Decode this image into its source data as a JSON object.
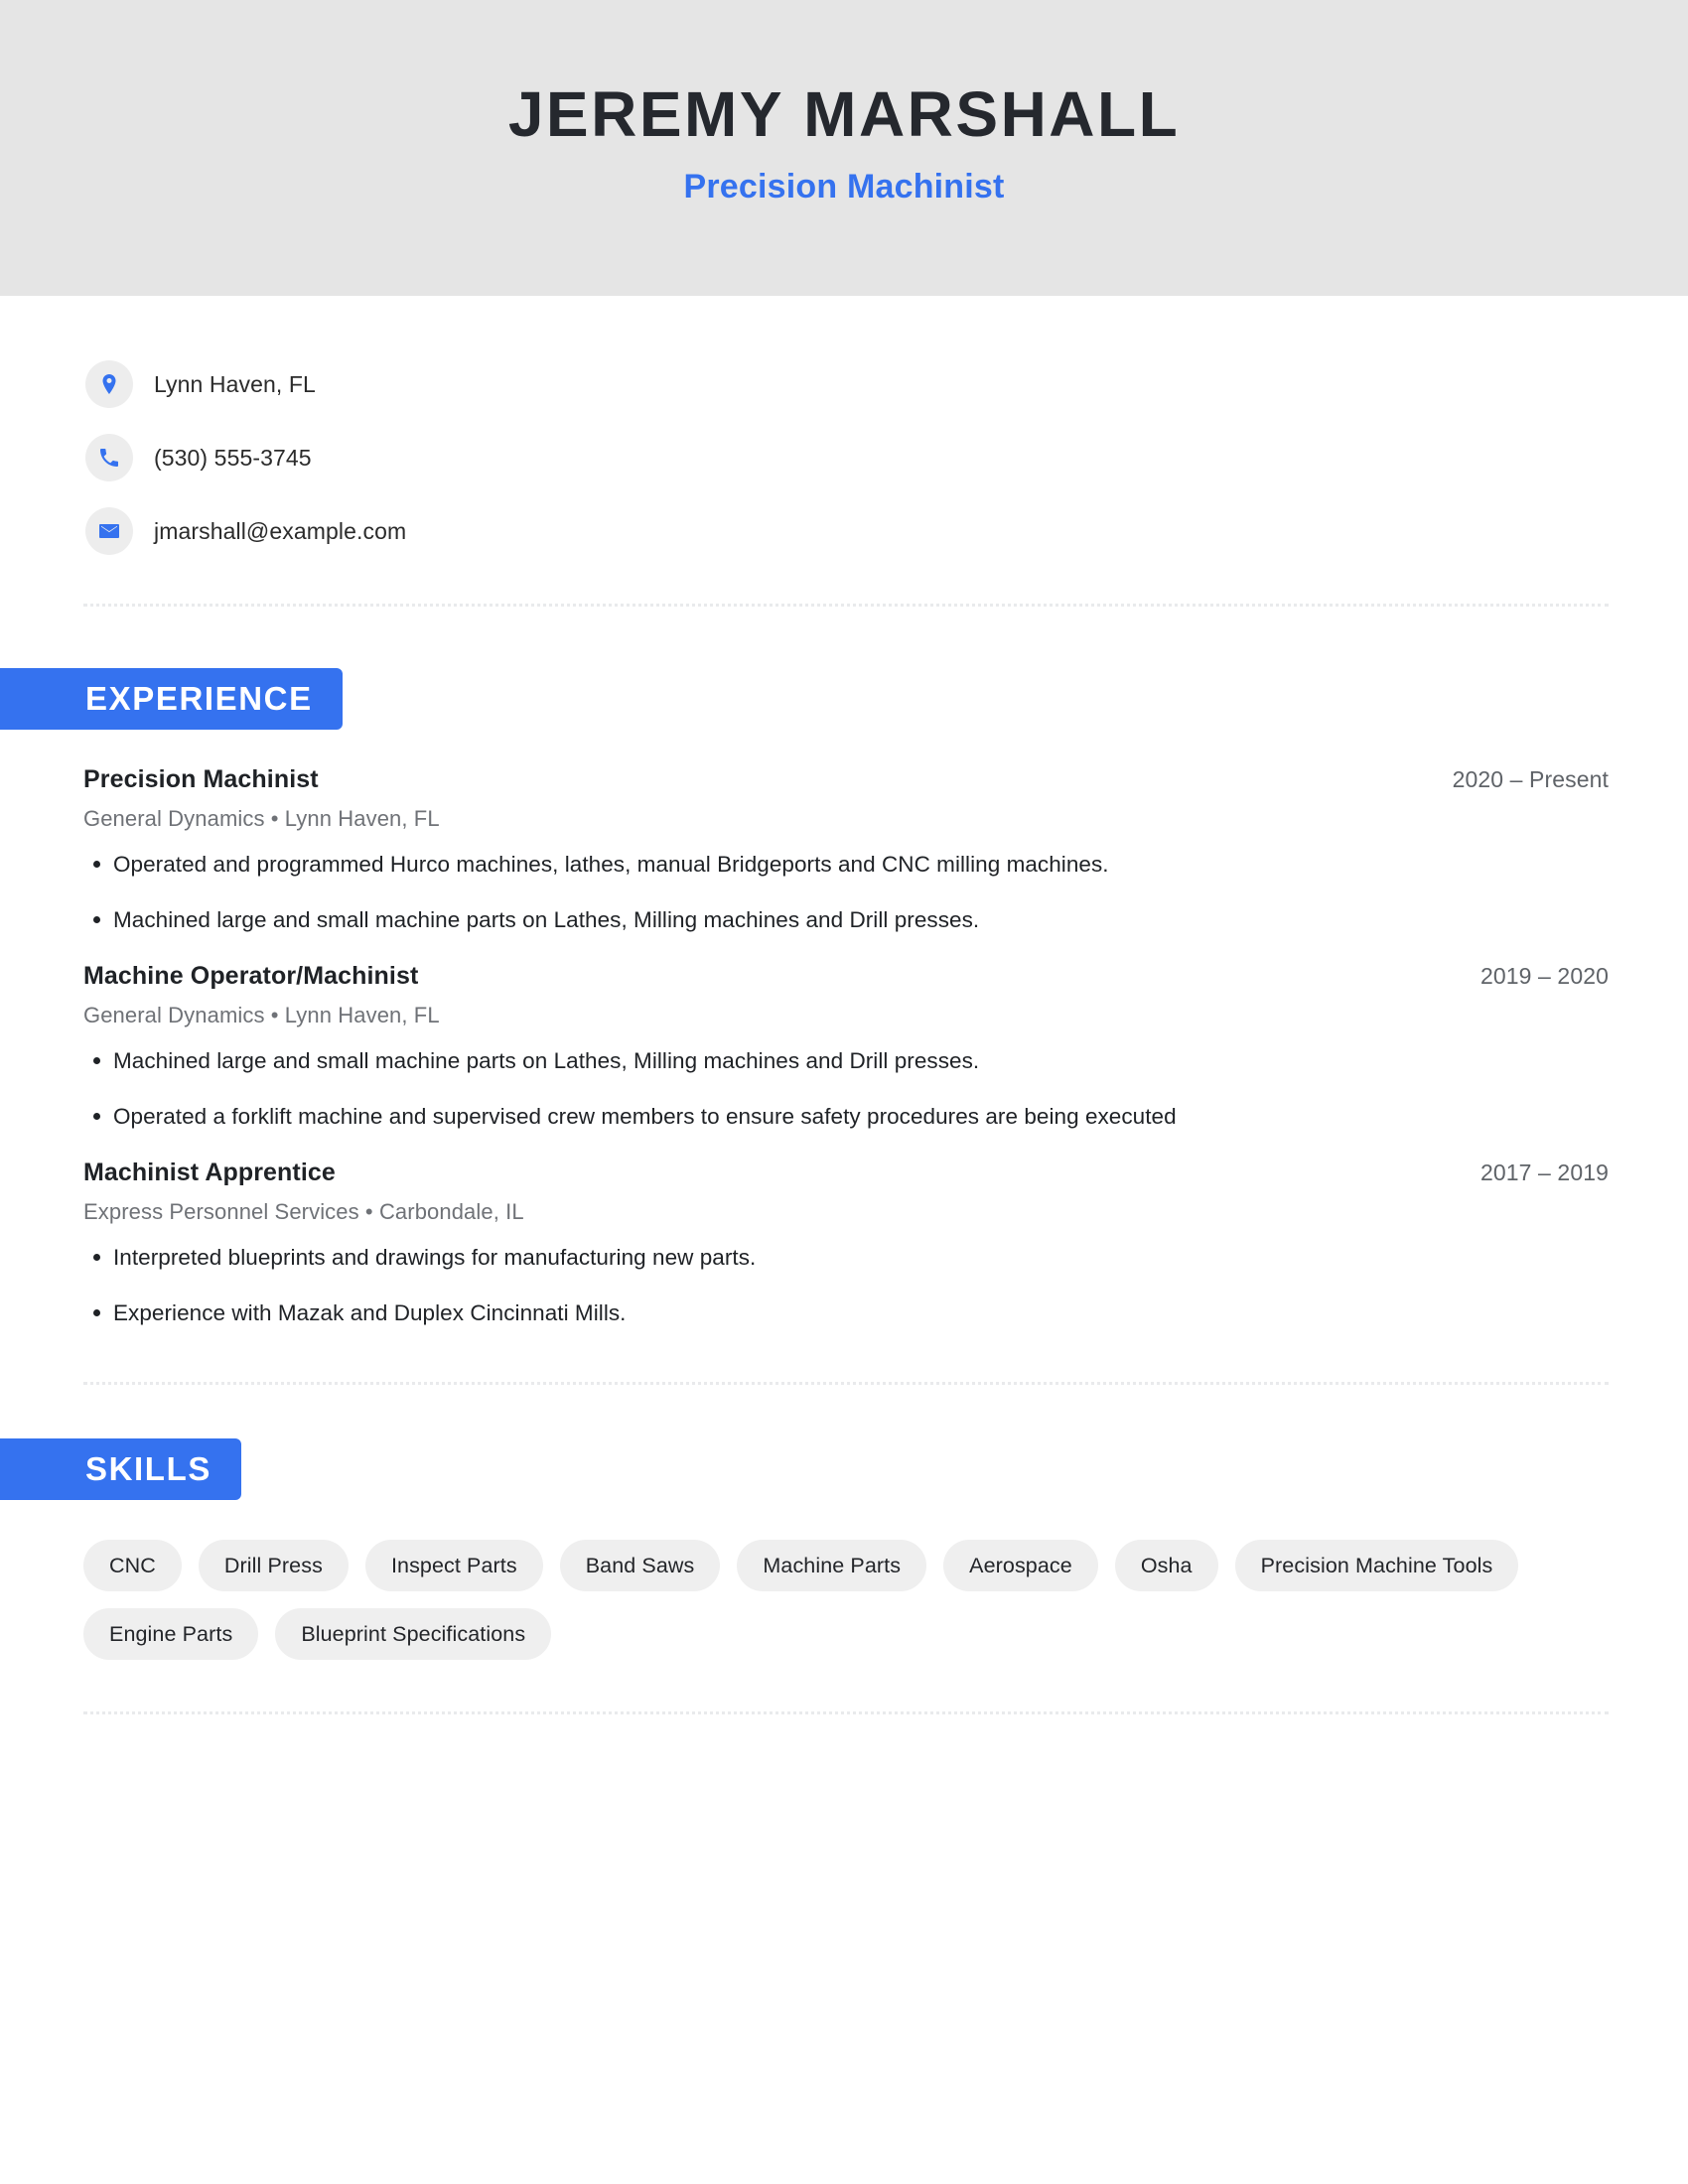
{
  "theme": {
    "accent": "#3572ef",
    "header_bg": "#e5e5e5",
    "name_color": "#25282e",
    "pill_bg": "#efefef",
    "icon_circle_bg": "#ededed",
    "muted_text": "#6f7277"
  },
  "header": {
    "name": "JEREMY MARSHALL",
    "subtitle": "Precision Machinist"
  },
  "contact": {
    "items": [
      {
        "icon": "location-pin-icon",
        "text": "Lynn Haven, FL"
      },
      {
        "icon": "phone-icon",
        "text": "(530) 555-3745"
      },
      {
        "icon": "envelope-icon",
        "text": "jmarshall@example.com"
      }
    ]
  },
  "experience": {
    "heading": "EXPERIENCE",
    "jobs": [
      {
        "title": "Precision Machinist",
        "dates": "2020 – Present",
        "subtitle": "General Dynamics  • Lynn Haven, FL",
        "bullets": [
          "Operated and programmed Hurco machines, lathes, manual Bridgeports and CNC milling machines.",
          "Machined large and small machine parts on Lathes, Milling machines and Drill presses."
        ]
      },
      {
        "title": "Machine Operator/Machinist",
        "dates": "2019 – 2020",
        "subtitle": "General Dynamics  • Lynn Haven, FL",
        "bullets": [
          "Machined large and small machine parts on Lathes, Milling machines and Drill presses.",
          "Operated a forklift machine and supervised crew members to ensure safety procedures are being executed"
        ]
      },
      {
        "title": "Machinist Apprentice",
        "dates": "2017 – 2019",
        "subtitle": "Express Personnel Services  • Carbondale, IL",
        "bullets": [
          "Interpreted blueprints and drawings for manufacturing new parts.",
          "Experience with Mazak and Duplex Cincinnati Mills."
        ]
      }
    ]
  },
  "skills": {
    "heading": "SKILLS",
    "items": [
      "CNC",
      "Drill Press",
      "Inspect Parts",
      "Band Saws",
      "Machine Parts",
      "Aerospace",
      "Osha",
      "Precision Machine Tools",
      "Engine Parts",
      "Blueprint Specifications"
    ]
  }
}
